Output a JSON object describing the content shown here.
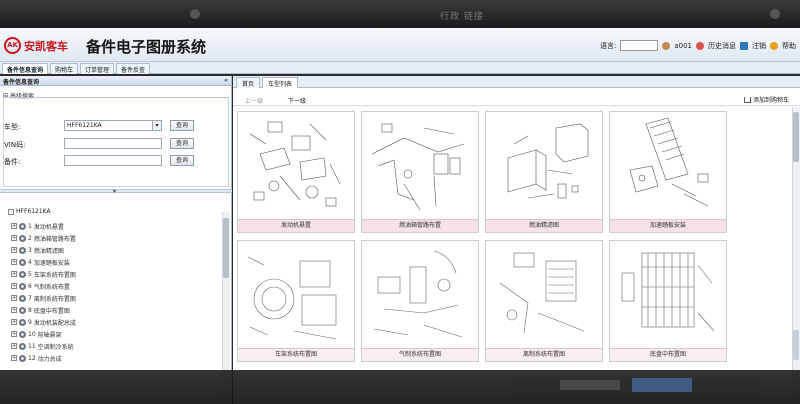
{
  "window": {
    "tab_title": "行政 链接"
  },
  "header": {
    "logo_mark": "AK",
    "brand": "安凯客车",
    "system_title": "备件电子图册系统",
    "language_label": "语言:",
    "user": "a001",
    "history": "历史消息",
    "logout": "注销",
    "help": "帮助"
  },
  "nav": {
    "tabs": [
      {
        "label": "备件信息查询"
      },
      {
        "label": "购物车"
      },
      {
        "label": "订单管理"
      },
      {
        "label": "备件反查"
      }
    ]
  },
  "left": {
    "panel_title": "备件信息查询",
    "advanced_search": "高级搜索",
    "fields": {
      "model_label": "车型:",
      "model_value": "HFF6121KA",
      "vin_label": "VIN码:",
      "part_label": "备件:"
    },
    "query_button": "查询",
    "tree_root": "HFF6121KA",
    "tree_items": [
      {
        "num": "1",
        "label": "发动机悬置"
      },
      {
        "num": "2",
        "label": "燃油箱管路布置"
      },
      {
        "num": "3",
        "label": "燃油精滤图"
      },
      {
        "num": "4",
        "label": "加速踏板安装"
      },
      {
        "num": "5",
        "label": "车架系统布置图"
      },
      {
        "num": "6",
        "label": "气制系统布置"
      },
      {
        "num": "7",
        "label": "离制系统布置图"
      },
      {
        "num": "8",
        "label": "底盘中布置图"
      },
      {
        "num": "9",
        "label": "发动机装配总成"
      },
      {
        "num": "10",
        "label": "前轴悬架"
      },
      {
        "num": "11",
        "label": "空调制冷系统"
      },
      {
        "num": "12",
        "label": "动力总成"
      }
    ]
  },
  "right": {
    "tabs": [
      {
        "label": "首页"
      },
      {
        "label": "车型列表"
      }
    ],
    "prev": "上一级",
    "next": "下一级",
    "add_to_cart": "添加到购物车",
    "cards": [
      {
        "caption": "发动机悬置"
      },
      {
        "caption": "燃油箱管路布置"
      },
      {
        "caption": "燃油精滤图"
      },
      {
        "caption": "加速踏板安装"
      },
      {
        "caption": "车架系统布置图"
      },
      {
        "caption": "气制系统布置图"
      },
      {
        "caption": "离制系统布置图"
      },
      {
        "caption": "底盘中布置图"
      }
    ]
  }
}
